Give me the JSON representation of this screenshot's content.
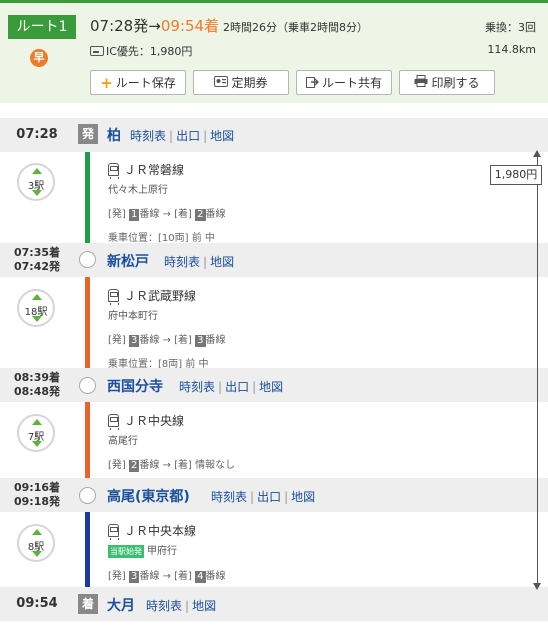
{
  "header": {
    "route_label": "ルート1",
    "fare_badge": "早",
    "departure": "07:28発",
    "arrow": "→",
    "arrival": "09:54着",
    "duration": "2時間26分（乗車2時間8分）",
    "transfers": "乗換：3回",
    "ic_fare": "IC優先：1,980円",
    "distance": "114.8km",
    "buttons": {
      "save": "ルート保存",
      "pass": "定期券",
      "share": "ルート共有",
      "print": "印刷する"
    }
  },
  "colors": {
    "green_line": "#1e9a4a",
    "orange_line": "#e8642c",
    "navy_line": "#1c3b9a",
    "accent_orange": "#f07a2a",
    "link_blue": "#1a4f9c"
  },
  "stations": [
    {
      "times": [
        "07:28"
      ],
      "marker": "発",
      "name": "柏",
      "links": [
        "時刻表",
        "出口",
        "地図"
      ]
    },
    {
      "times": [
        "07:35着",
        "07:42発"
      ],
      "marker": "",
      "name": "新松戸",
      "links": [
        "時刻表",
        "地図"
      ]
    },
    {
      "times": [
        "08:39着",
        "08:48発"
      ],
      "marker": "",
      "name": "西国分寺",
      "links": [
        "時刻表",
        "出口",
        "地図"
      ]
    },
    {
      "times": [
        "09:16着",
        "09:18発"
      ],
      "marker": "",
      "name": "高尾(東京都)",
      "links": [
        "時刻表",
        "出口",
        "地図"
      ]
    },
    {
      "times": [
        "09:54"
      ],
      "marker": "着",
      "name": "大月",
      "links": [
        "時刻表",
        "地図"
      ]
    }
  ],
  "segments": [
    {
      "count": "3駅",
      "line": "ＪＲ常磐線",
      "origin_badge": "",
      "dest": "代々木上原行",
      "plat_dep_label": "[発]",
      "plat_dep": "1",
      "plat_suffix": "番線",
      "plat_arr_label": "[着]",
      "plat_arr": "2",
      "plat_arr_suffix": "番線",
      "position": "乗車位置：[10両] 前 中"
    },
    {
      "count": "18駅",
      "line": "ＪＲ武蔵野線",
      "origin_badge": "",
      "dest": "府中本町行",
      "plat_dep_label": "[発]",
      "plat_dep": "3",
      "plat_suffix": "番線",
      "plat_arr_label": "[着]",
      "plat_arr": "3",
      "plat_arr_suffix": "番線",
      "position": "乗車位置：[8両] 前 中"
    },
    {
      "count": "7駅",
      "line": "ＪＲ中央線",
      "origin_badge": "",
      "dest": "高尾行",
      "plat_dep_label": "[発]",
      "plat_dep": "2",
      "plat_suffix": "番線",
      "plat_arr_label": "[着]",
      "plat_arr": "",
      "plat_arr_suffix": "情報なし",
      "position": ""
    },
    {
      "count": "8駅",
      "line": "ＪＲ中央本線",
      "origin_badge": "当駅始発",
      "dest": "甲府行",
      "plat_dep_label": "[発]",
      "plat_dep": "3",
      "plat_suffix": "番線",
      "plat_arr_label": "[着]",
      "plat_arr": "4",
      "plat_arr_suffix": "番線",
      "position": ""
    }
  ],
  "fare_total": "1,980円"
}
